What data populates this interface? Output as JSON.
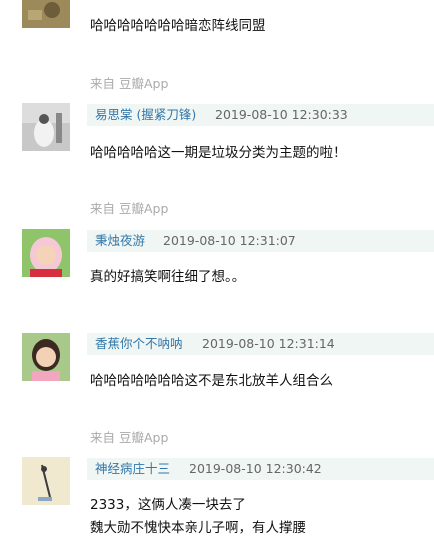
{
  "comments": [
    {
      "text_lines": [
        "哈哈哈哈哈哈哈暗恋阵线同盟"
      ],
      "source": "来自 豆瓣App"
    },
    {
      "author": "易思棠 (握紧刀锋)",
      "timestamp": "2019-08-10 12:30:33",
      "text_lines": [
        "哈哈哈哈哈这一期是垃圾分类为主题的啦！"
      ],
      "source": "来自 豆瓣App"
    },
    {
      "author": "秉烛夜游",
      "timestamp": "2019-08-10 12:31:07",
      "text_lines": [
        "真的好搞笑啊往细了想。。"
      ]
    },
    {
      "author": "香蕉你个不呐呐",
      "timestamp": "2019-08-10 12:31:14",
      "text_lines": [
        "哈哈哈哈哈哈哈这不是东北放羊人组合么"
      ],
      "source": "来自 豆瓣App"
    },
    {
      "author": "神经病庄十三",
      "timestamp": "2019-08-10 12:30:42",
      "text_lines": [
        "2333，这俩人凑一块去了",
        "魏大勋不愧快本亲儿子啊，有人撑腰"
      ]
    }
  ]
}
